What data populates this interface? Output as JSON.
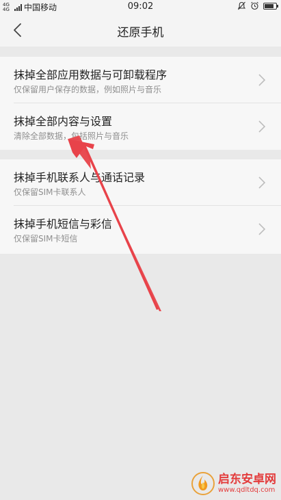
{
  "status_bar": {
    "network_tag": "4G 4G",
    "carrier": "中国移动",
    "time": "09:02",
    "battery_level": 0.8
  },
  "header": {
    "title": "还原手机",
    "back_icon": "chevron-left-icon"
  },
  "groups": [
    {
      "items": [
        {
          "title": "抹掉全部应用数据与可卸载程序",
          "subtitle": "仅保留用户保存的数据，例如照片与音乐"
        },
        {
          "title": "抹掉全部内容与设置",
          "subtitle": "清除全部数据，包括照片与音乐"
        }
      ]
    },
    {
      "items": [
        {
          "title": "抹掉手机联系人与通话记录",
          "subtitle": "仅保留SIM卡联系人"
        },
        {
          "title": "抹掉手机短信与彩信",
          "subtitle": "仅保留SIM卡短信"
        }
      ]
    }
  ],
  "annotation": {
    "color": "#e8434a",
    "icon": "pointer-arrow-icon"
  },
  "watermark": {
    "text": "启东安卓网",
    "url": "www.qdltdq.com",
    "logo_icon": "flame-logo-icon"
  }
}
